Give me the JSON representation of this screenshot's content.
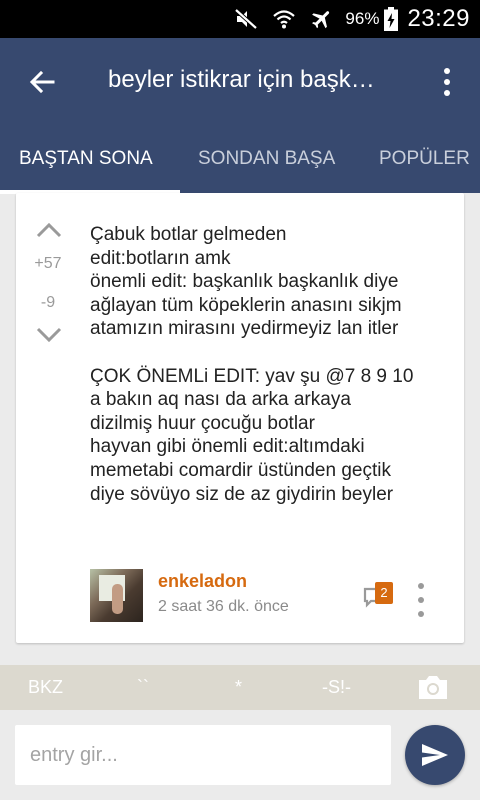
{
  "status_bar": {
    "battery_percent": "96%",
    "time": "23:29",
    "icons": [
      "mute-icon",
      "wifi-icon",
      "airplane-icon",
      "battery-charging-icon"
    ]
  },
  "app_bar": {
    "title": "beyler istikrar için başk…",
    "back_icon": "arrow-back-icon",
    "more_icon": "more-vert-icon"
  },
  "tabs": [
    {
      "label": "BAŞTAN SONA",
      "active": true
    },
    {
      "label": "SONDAN BAŞA",
      "active": false
    },
    {
      "label": "POPÜLER",
      "active": false
    }
  ],
  "entry": {
    "upvotes": "+57",
    "downvotes": "-9",
    "lines": [
      "Çabuk botlar gelmeden",
      "edit:botların amk",
      "önemli edit: başkanlık başkanlık diye",
      "ağlayan tüm köpeklerin anasını sikjm",
      "atamızın mirasını yedirmeyiz lan itler",
      "",
      "ÇOK ÖNEMLi EDIT: yav şu @7 8 9 10",
      "a bakın aq nası da arka arkaya",
      "dizilmiş huur çocuğu botlar",
      "hayvan gibi önemli edit:altımdaki",
      "memetabi comardir üstünden geçtik",
      "diye sövüyo siz de az giydirin beyler"
    ],
    "author": "enkeladon",
    "time_ago": "2 saat 36 dk. önce",
    "comment_count": "2"
  },
  "format_bar": {
    "buttons": [
      "BKZ",
      "``",
      "*",
      "-S!-"
    ],
    "camera_icon": "camera-icon"
  },
  "input": {
    "placeholder": "entry gir...",
    "value": ""
  },
  "colors": {
    "primary": "#37496f",
    "accent": "#d66a10",
    "format_bar": "#dcd9cf",
    "background": "#ebebeb"
  }
}
